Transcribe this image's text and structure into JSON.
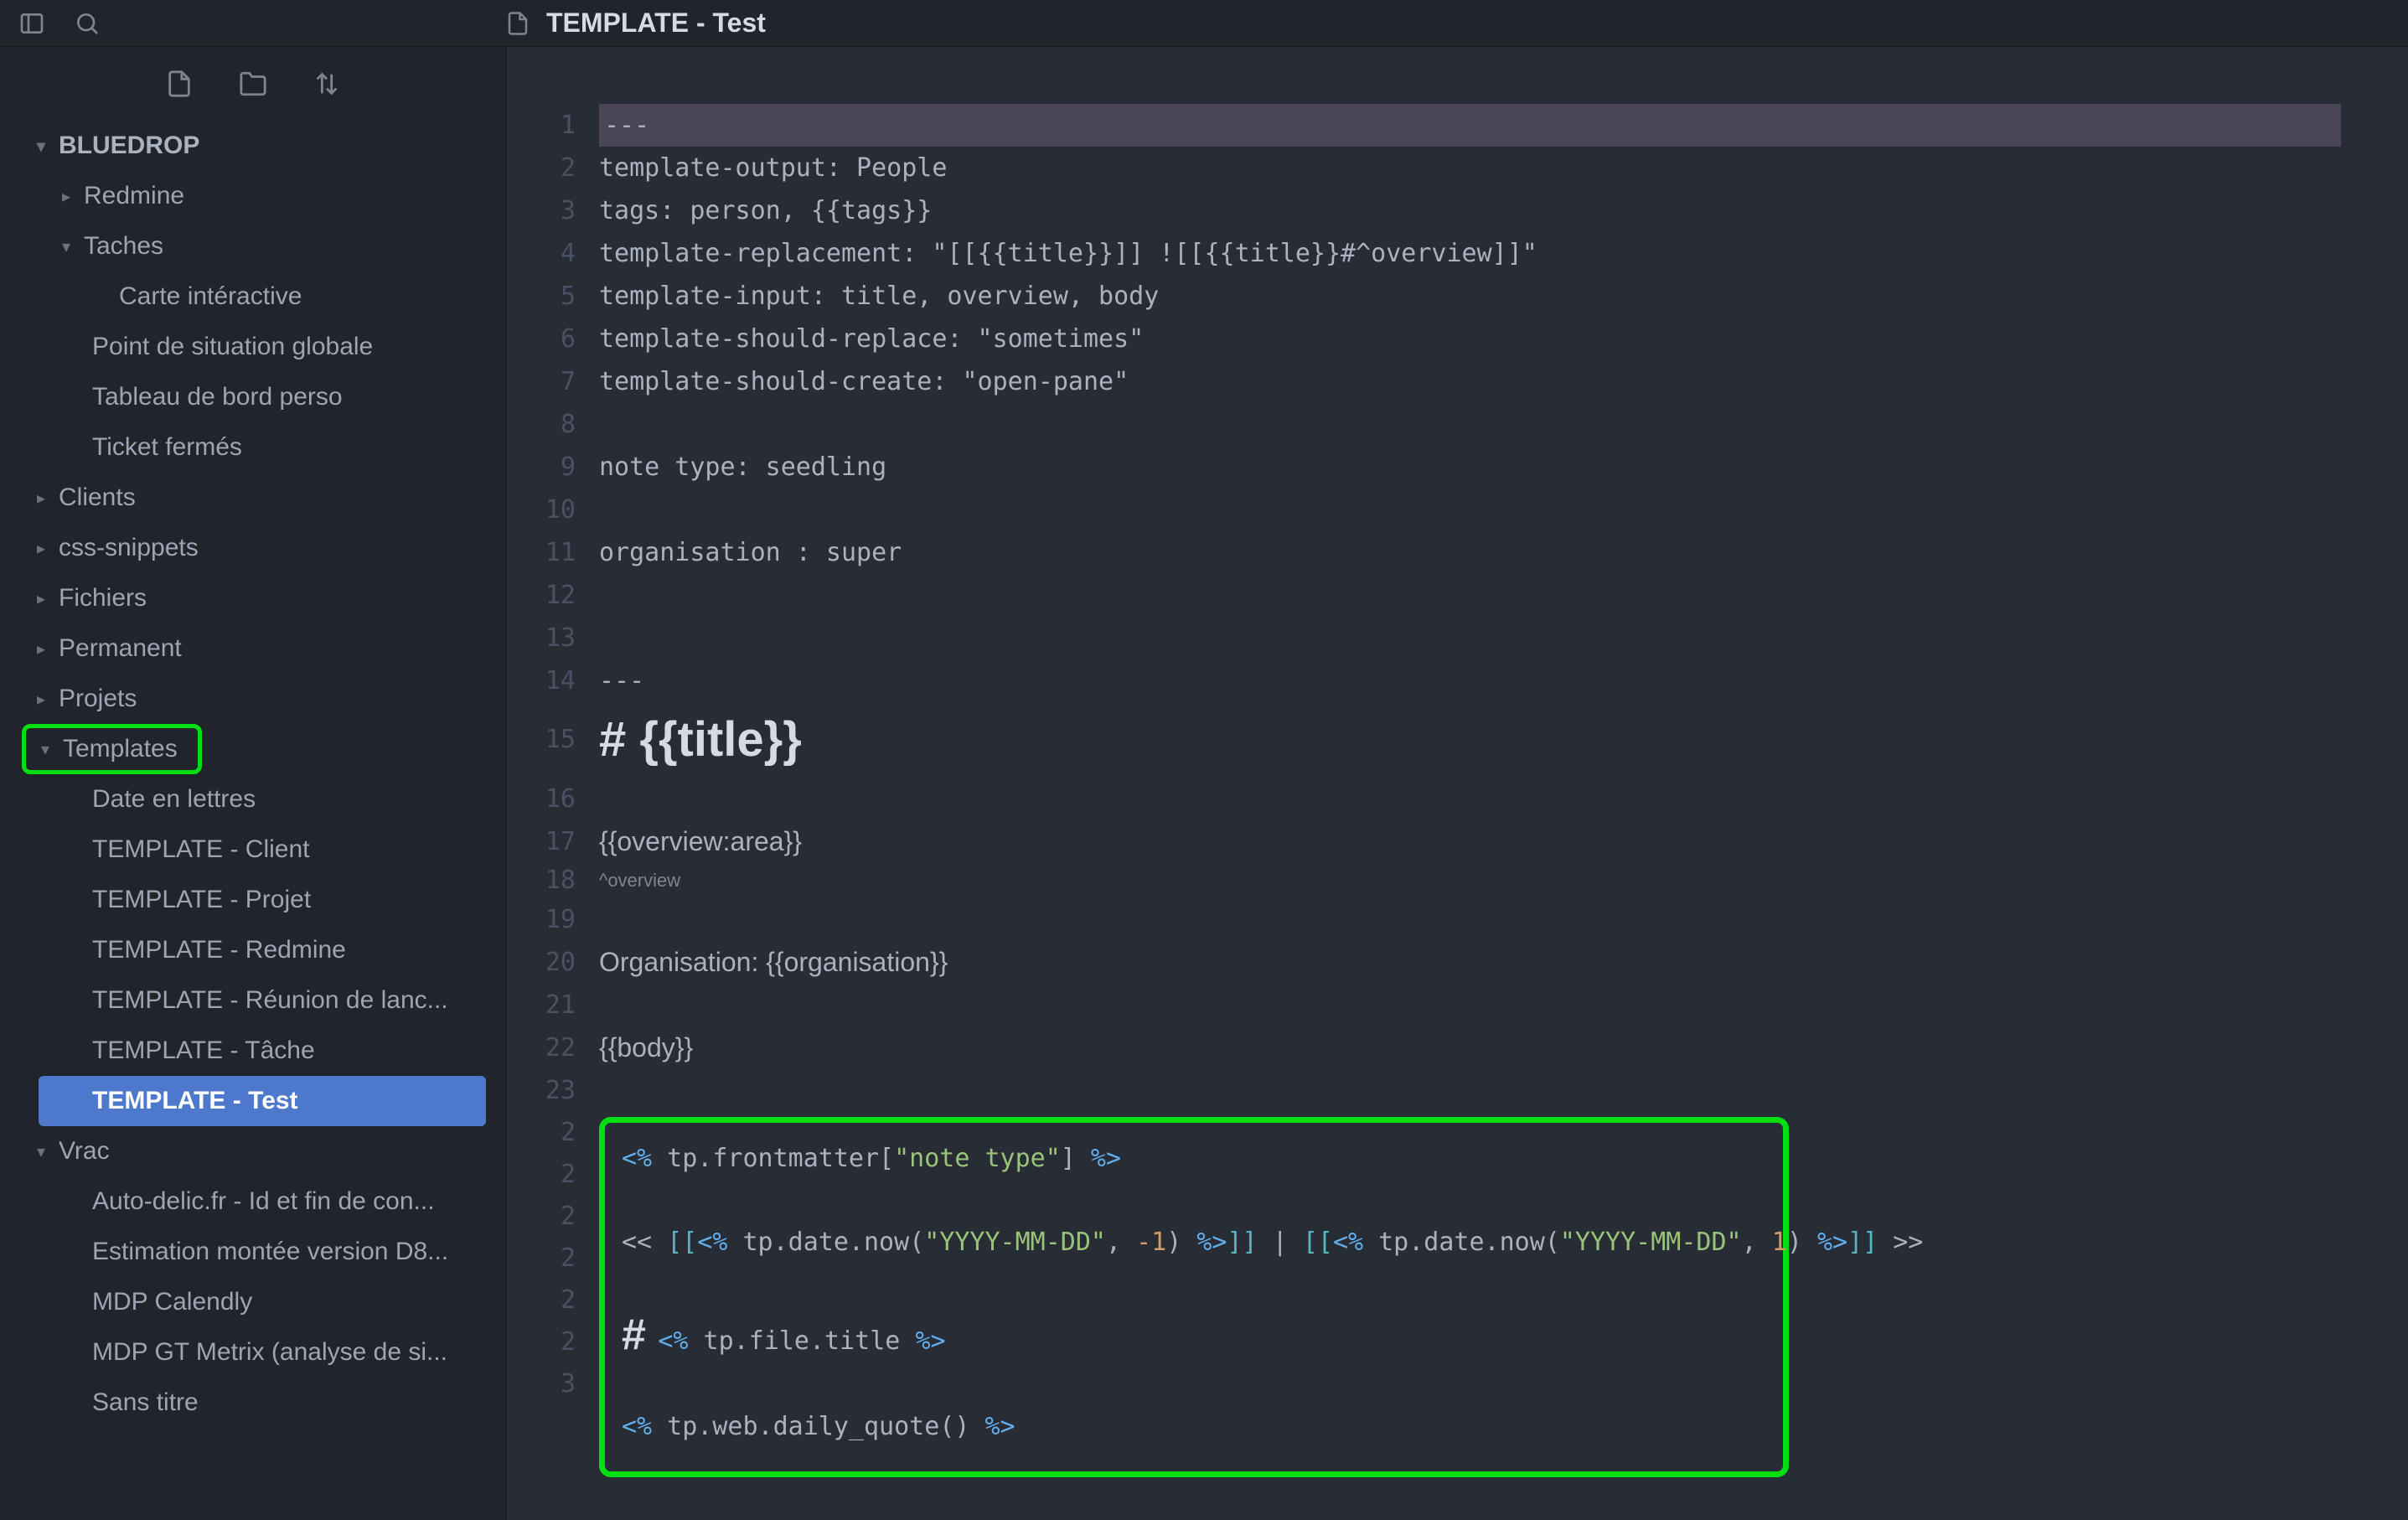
{
  "titlebar": {
    "document_title": "TEMPLATE - Test"
  },
  "sidebar": {
    "vault_name": "BLUEDROP",
    "tree": [
      {
        "label": "Redmine",
        "level": 1,
        "caret": "right"
      },
      {
        "label": "Taches",
        "level": 1,
        "caret": "down"
      },
      {
        "label": "Carte intéractive",
        "level": 3,
        "caret": ""
      },
      {
        "label": "Point de situation globale",
        "level": 2,
        "caret": ""
      },
      {
        "label": "Tableau de bord perso",
        "level": 2,
        "caret": ""
      },
      {
        "label": "Ticket fermés",
        "level": 2,
        "caret": ""
      },
      {
        "label": "Clients",
        "level": 1,
        "caret": "right",
        "root": true
      },
      {
        "label": "css-snippets",
        "level": 1,
        "caret": "right",
        "root": true
      },
      {
        "label": "Fichiers",
        "level": 1,
        "caret": "right",
        "root": true
      },
      {
        "label": "Permanent",
        "level": 1,
        "caret": "right",
        "root": true
      },
      {
        "label": "Projets",
        "level": 1,
        "caret": "right",
        "root": true
      },
      {
        "label": "Templates",
        "level": 1,
        "caret": "down",
        "root": true,
        "highlighted": true
      },
      {
        "label": "Date en lettres",
        "level": 2,
        "caret": ""
      },
      {
        "label": "TEMPLATE - Client",
        "level": 2,
        "caret": ""
      },
      {
        "label": "TEMPLATE - Projet",
        "level": 2,
        "caret": ""
      },
      {
        "label": "TEMPLATE - Redmine",
        "level": 2,
        "caret": ""
      },
      {
        "label": "TEMPLATE - Réunion de lanc...",
        "level": 2,
        "caret": ""
      },
      {
        "label": "TEMPLATE - Tâche",
        "level": 2,
        "caret": ""
      },
      {
        "label": "TEMPLATE - Test",
        "level": 2,
        "caret": "",
        "active": true
      },
      {
        "label": "Vrac",
        "level": 1,
        "caret": "down",
        "root": true
      },
      {
        "label": "Auto-delic.fr - Id et fin de con...",
        "level": 2,
        "caret": ""
      },
      {
        "label": "Estimation montée version D8...",
        "level": 2,
        "caret": ""
      },
      {
        "label": "MDP Calendly",
        "level": 2,
        "caret": ""
      },
      {
        "label": "MDP GT Metrix (analyse de si...",
        "level": 2,
        "caret": ""
      },
      {
        "label": "Sans titre",
        "level": 2,
        "caret": ""
      }
    ]
  },
  "editor": {
    "lines": [
      {
        "n": 1,
        "t": "---",
        "first": true
      },
      {
        "n": 2,
        "t": "template-output: People"
      },
      {
        "n": 3,
        "t": "tags: person, {{tags}}"
      },
      {
        "n": 4,
        "t": "template-replacement: \"[[{{title}}]] ![[{{title}}#^overview]]\""
      },
      {
        "n": 5,
        "t": "template-input: title, overview, body"
      },
      {
        "n": 6,
        "t": "template-should-replace: \"sometimes\""
      },
      {
        "n": 7,
        "t": "template-should-create: \"open-pane\""
      },
      {
        "n": 8,
        "t": ""
      },
      {
        "n": 9,
        "t": "note type: seedling"
      },
      {
        "n": 10,
        "t": ""
      },
      {
        "n": 11,
        "t": "organisation : super"
      },
      {
        "n": 12,
        "t": ""
      },
      {
        "n": 13,
        "t": ""
      },
      {
        "n": 14,
        "t": "---"
      },
      {
        "n": 15,
        "t": "# {{title}}",
        "h1": true
      },
      {
        "n": 16,
        "t": "",
        "body": true
      },
      {
        "n": 17,
        "t": "{{overview:area}}",
        "body": true
      },
      {
        "n": 18,
        "t": "^overview",
        "small": true
      },
      {
        "n": 19,
        "t": "",
        "body": true
      },
      {
        "n": 20,
        "t": "Organisation: {{organisation}}",
        "body": true
      },
      {
        "n": 21,
        "t": "",
        "body": true
      },
      {
        "n": 22,
        "t": "{{body}}",
        "body": true
      },
      {
        "n": 23,
        "t": "",
        "body": true
      }
    ],
    "box": {
      "line_tag_open": "<%",
      "line_tag_close": "%>",
      "lnums": [
        "2",
        "2",
        "2",
        "2",
        "2",
        "2",
        "3"
      ],
      "l1_expr": " tp.frontmatter[\"note type\"] ",
      "l1_str": "\"note type\"",
      "l2_prefix": "<< ",
      "l2_link_open": "[[",
      "l2_link_close": "]]",
      "l2_date_call": " tp.date.now(",
      "l2_date_fmt": "\"YYYY-MM-DD\"",
      "l2_comma": ", ",
      "l2_neg1": "-1",
      "l2_pos1": "1",
      "l2_close": ") ",
      "l2_pipe": " | ",
      "l2_suffix": " >>",
      "l3_hash": "# ",
      "l3_title": " tp.file.title ",
      "l4_quote": " tp.web.daily_quote() "
    }
  }
}
